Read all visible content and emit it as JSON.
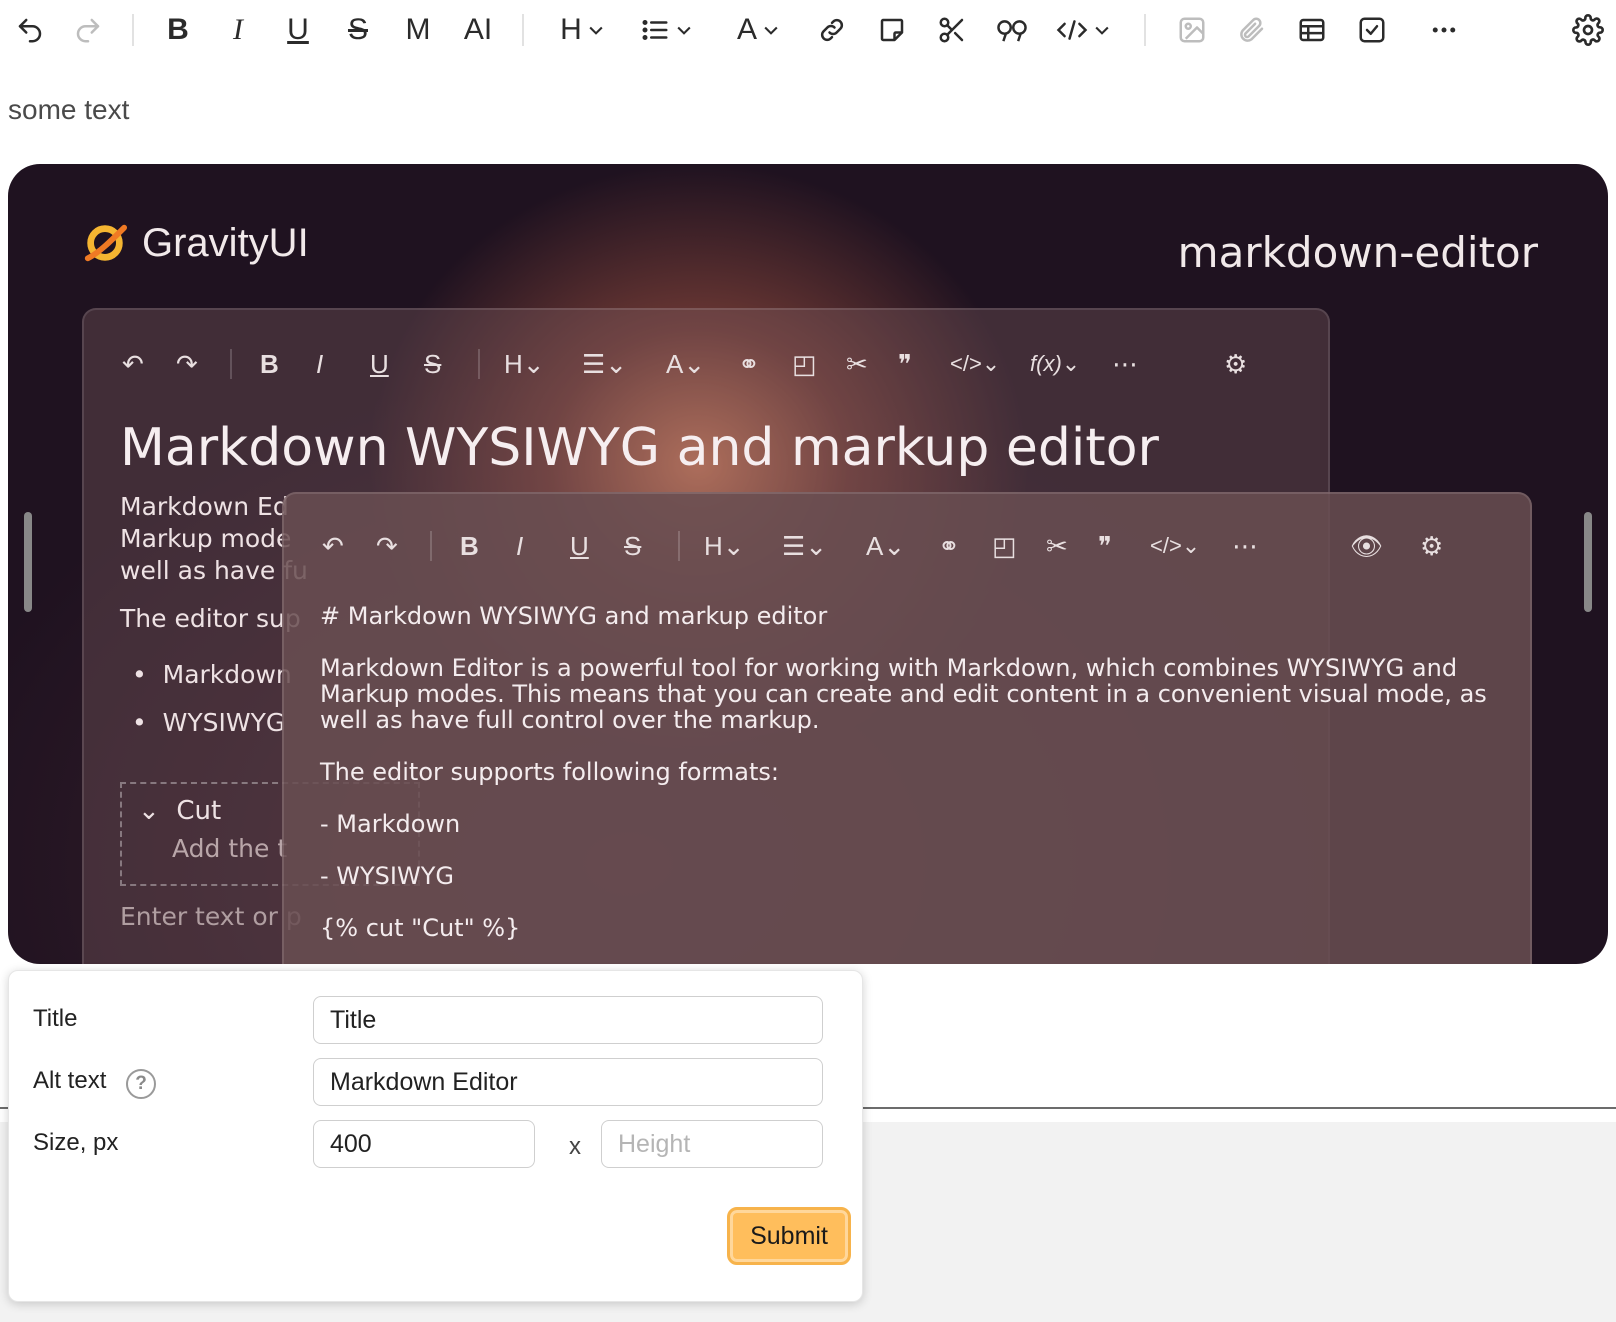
{
  "toolbar": {
    "items": [
      {
        "name": "undo-button",
        "icon": "undo-icon"
      },
      {
        "name": "redo-button",
        "icon": "redo-icon",
        "disabled": true
      },
      {
        "name": "bold-button",
        "label": "B"
      },
      {
        "name": "italic-button",
        "label": "I"
      },
      {
        "name": "underline-button",
        "label": "U"
      },
      {
        "name": "strikethrough-button",
        "label": "S"
      },
      {
        "name": "mono-button",
        "label": "M"
      },
      {
        "name": "mark-button",
        "label": "AI"
      },
      {
        "name": "heading-dropdown",
        "label": "H"
      },
      {
        "name": "list-dropdown",
        "icon": "list-icon"
      },
      {
        "name": "text-color-dropdown",
        "label": "A"
      },
      {
        "name": "link-button",
        "icon": "link-icon"
      },
      {
        "name": "note-button",
        "icon": "note-icon"
      },
      {
        "name": "cut-button",
        "icon": "scissors-icon"
      },
      {
        "name": "quote-button",
        "icon": "quote-icon"
      },
      {
        "name": "code-dropdown",
        "label": "</>"
      },
      {
        "name": "image-button",
        "icon": "image-icon",
        "disabled": true
      },
      {
        "name": "file-button",
        "icon": "paperclip-icon",
        "disabled": true
      },
      {
        "name": "table-button",
        "icon": "table-icon"
      },
      {
        "name": "checkbox-button",
        "icon": "checkbox-icon"
      },
      {
        "name": "more-button",
        "label": "..."
      },
      {
        "name": "settings-button",
        "icon": "gear-icon"
      }
    ]
  },
  "document": {
    "text": "some text"
  },
  "image": {
    "brand": "GravityUI",
    "product": "markdown-editor",
    "back_editor": {
      "title": "Markdown WYSIWYG and markup editor",
      "line1": "Markdown Ed",
      "line2": "Markup mode",
      "line3": "well as have fu",
      "line4": "The editor sup",
      "bullet1": "Markdown",
      "bullet2": "WYSIWYG",
      "cut_title": "Cut",
      "cut_body": "Add the t",
      "placeholder": "Enter text or p",
      "toolbar_formula": "f(x)"
    },
    "front_editor": {
      "heading": "# Markdown WYSIWYG and markup editor",
      "p1_l1": "Markdown Editor is a powerful tool for working with Markdown, which combines WYSIWYG and",
      "p1_l2": "Markup modes. This means that you can create and edit content in a convenient visual mode, as",
      "p1_l3": "well as have full control over the markup.",
      "p2": "The editor supports following formats:",
      "li1": "- Markdown",
      "li2": "- WYSIWYG",
      "cut": "{% cut \"Cut\" %}"
    }
  },
  "image_form": {
    "title_label": "Title",
    "title_value": "Title",
    "alt_label": "Alt text",
    "alt_value": "Markdown Editor",
    "help_icon": "?",
    "size_label": "Size, px",
    "width_value": "400",
    "height_placeholder": "Height",
    "size_separator": "x",
    "submit_label": "Submit",
    "submit_color": "#ffbe5c"
  }
}
